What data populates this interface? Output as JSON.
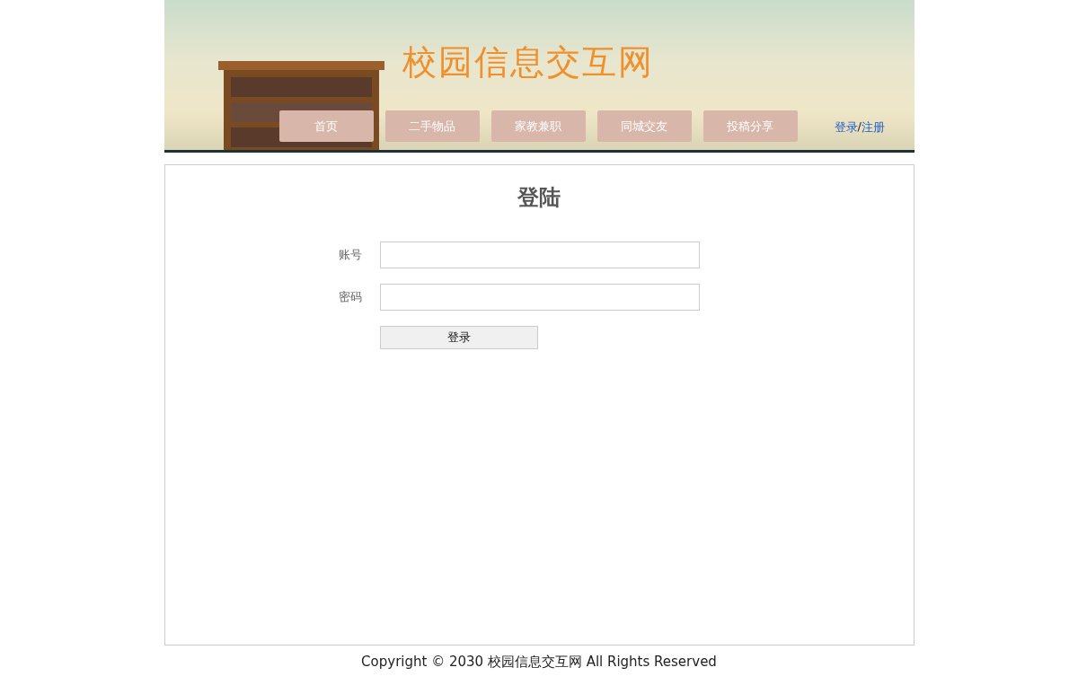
{
  "header": {
    "title": "校园信息交互网",
    "nav": [
      "首页",
      "二手物品",
      "家教兼职",
      "同城交友",
      "投稿分享"
    ],
    "auth_links": {
      "login": "登录",
      "separator": "/",
      "register": "注册"
    }
  },
  "login_form": {
    "title": "登陆",
    "fields": [
      {
        "label": "账号"
      },
      {
        "label": "密码"
      }
    ],
    "submit": "登录"
  },
  "footer": "Copyright © 2030 校园信息交互网 All Rights Reserved"
}
